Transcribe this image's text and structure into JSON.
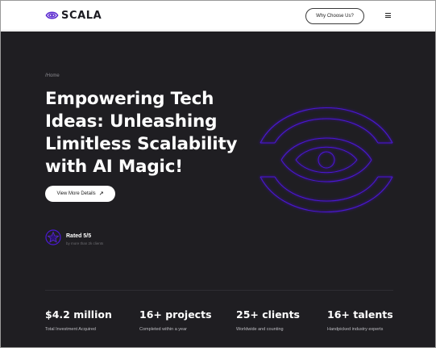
{
  "colors": {
    "header_bg": "#ffffff",
    "hero_bg": "#1f1e22",
    "accent": "#4a18d6",
    "text_light": "#ffffff",
    "text_muted": "#8a8a8f"
  },
  "header": {
    "logo_text": "SCALA",
    "logo_icon": "scala-eye-logo-icon",
    "why_button_label": "Why Choose Us?",
    "menu_icon": "hamburger-menu-icon",
    "menu_glyph": "≡"
  },
  "hero": {
    "breadcrumb": "/Home",
    "headline": "Empowering Tech\nIdeas: Unleashing\nLimitless Scalability\nwith AI Magic!",
    "cta_label": "View More Details",
    "cta_icon": "arrow-up-right-icon",
    "cta_glyph": "↗",
    "emblem_icon": "scala-eye-emblem-icon"
  },
  "rating": {
    "icon": "star-badge-icon",
    "title": "Rated 5/5",
    "subtitle": "by more than 2k clients"
  },
  "stats": [
    {
      "value": "$4.2 million",
      "label": "Total Investment Acquired"
    },
    {
      "value": "16+ projects",
      "label": "Completed within a year"
    },
    {
      "value": "25+ clients",
      "label": "Worldwide and counting"
    },
    {
      "value": "16+ talents",
      "label": "Handpicked industry experts"
    }
  ]
}
